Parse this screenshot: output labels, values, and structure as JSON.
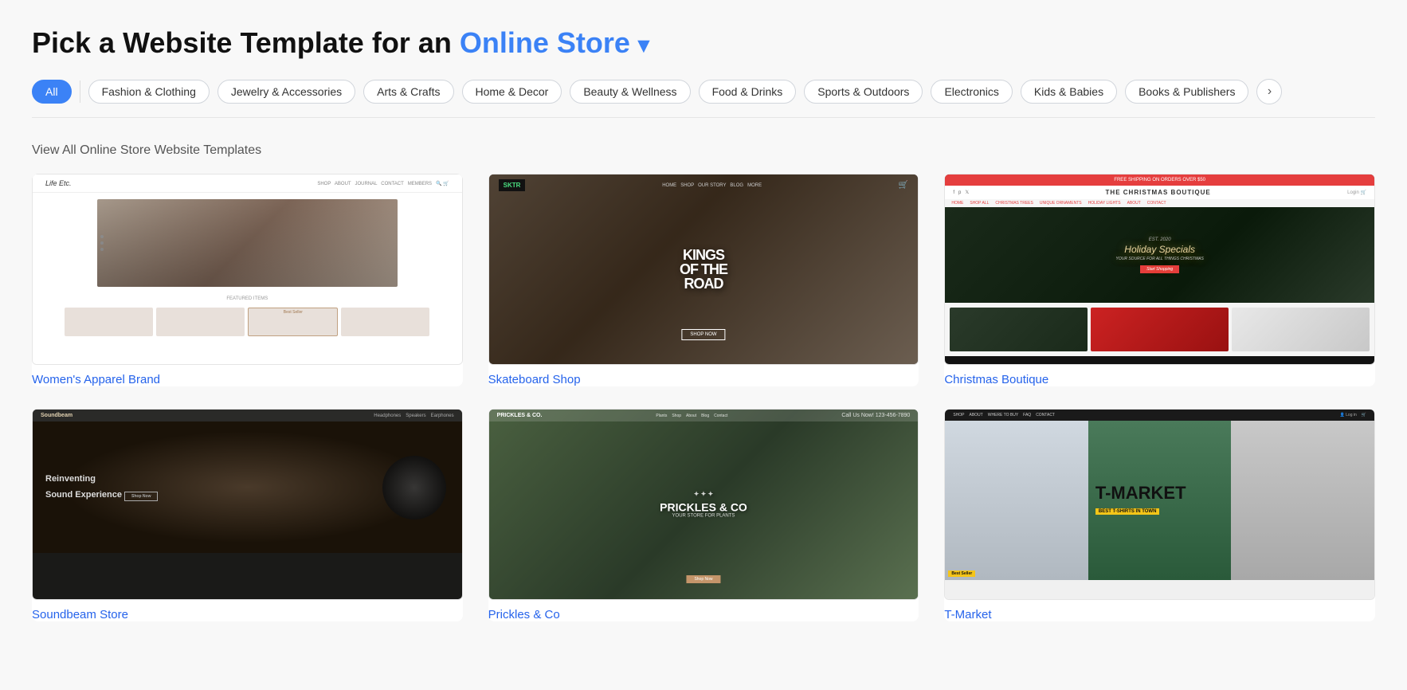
{
  "page": {
    "title_prefix": "Pick a Website Template for an",
    "title_highlight": "Online Store",
    "section_label": "View All Online Store Website Templates"
  },
  "categories": [
    {
      "id": "all",
      "label": "All",
      "active": true
    },
    {
      "id": "fashion",
      "label": "Fashion & Clothing",
      "active": false
    },
    {
      "id": "jewelry",
      "label": "Jewelry & Accessories",
      "active": false
    },
    {
      "id": "arts",
      "label": "Arts & Crafts",
      "active": false
    },
    {
      "id": "home",
      "label": "Home & Decor",
      "active": false
    },
    {
      "id": "beauty",
      "label": "Beauty & Wellness",
      "active": false
    },
    {
      "id": "food",
      "label": "Food & Drinks",
      "active": false
    },
    {
      "id": "sports",
      "label": "Sports & Outdoors",
      "active": false
    },
    {
      "id": "electronics",
      "label": "Electronics",
      "active": false
    },
    {
      "id": "kids",
      "label": "Kids & Babies",
      "active": false
    },
    {
      "id": "books",
      "label": "Books & Publishers",
      "active": false
    }
  ],
  "templates": [
    {
      "id": "womens-apparel",
      "label": "Women's Apparel Brand",
      "type": "life-etc"
    },
    {
      "id": "skateboard-shop",
      "label": "Skateboard Shop",
      "type": "skate"
    },
    {
      "id": "christmas-boutique",
      "label": "Christmas Boutique",
      "type": "christmas"
    },
    {
      "id": "soundbeam",
      "label": "Soundbeam Store",
      "type": "soundbeam"
    },
    {
      "id": "prickles-co",
      "label": "Prickles & Co",
      "type": "prickles"
    },
    {
      "id": "tmarket",
      "label": "T-Market",
      "type": "tmarket"
    }
  ],
  "icons": {
    "chevron_down": "▾",
    "more": "›"
  }
}
